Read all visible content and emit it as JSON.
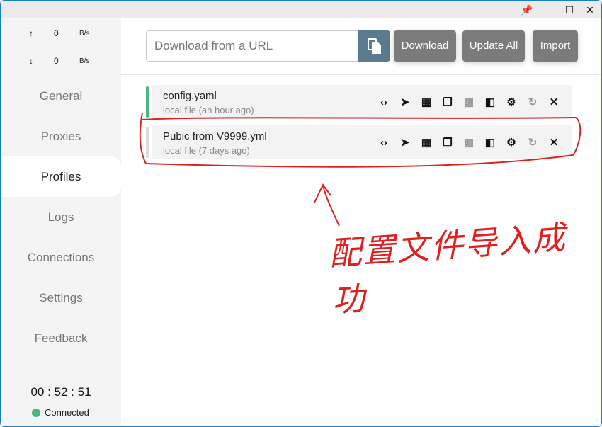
{
  "window": {
    "controls": [
      "pin",
      "minimize",
      "maximize",
      "close"
    ]
  },
  "traffic": {
    "up": {
      "arrow": "↑",
      "value": "0",
      "unit": "B/s"
    },
    "down": {
      "arrow": "↓",
      "value": "0",
      "unit": "B/s"
    }
  },
  "nav": [
    {
      "label": "General"
    },
    {
      "label": "Proxies"
    },
    {
      "label": "Profiles",
      "active": true
    },
    {
      "label": "Logs"
    },
    {
      "label": "Connections"
    },
    {
      "label": "Settings"
    },
    {
      "label": "Feedback"
    }
  ],
  "timer": "00 : 52 : 51",
  "status": {
    "label": "Connected",
    "color": "#45b883"
  },
  "toolbar": {
    "url_placeholder": "Download from a URL",
    "download": "Download",
    "update_all": "Update All",
    "import": "Import"
  },
  "profiles": [
    {
      "name": "config.yaml",
      "desc": "local file (an hour ago)",
      "selected": true,
      "bar_color": "#45b883"
    },
    {
      "name": "Pubic from V9999.yml",
      "desc": "local file (7 days ago)",
      "selected": false,
      "bar_color": "#dcdcdc"
    }
  ],
  "profile_actions": [
    "code-icon",
    "send-icon",
    "table-icon",
    "copy-icon",
    "qr-icon",
    "compare-icon",
    "gear-icon",
    "refresh-icon",
    "close-icon"
  ],
  "annotation": {
    "text": "配置文件导入成功",
    "color": "#e02020"
  }
}
